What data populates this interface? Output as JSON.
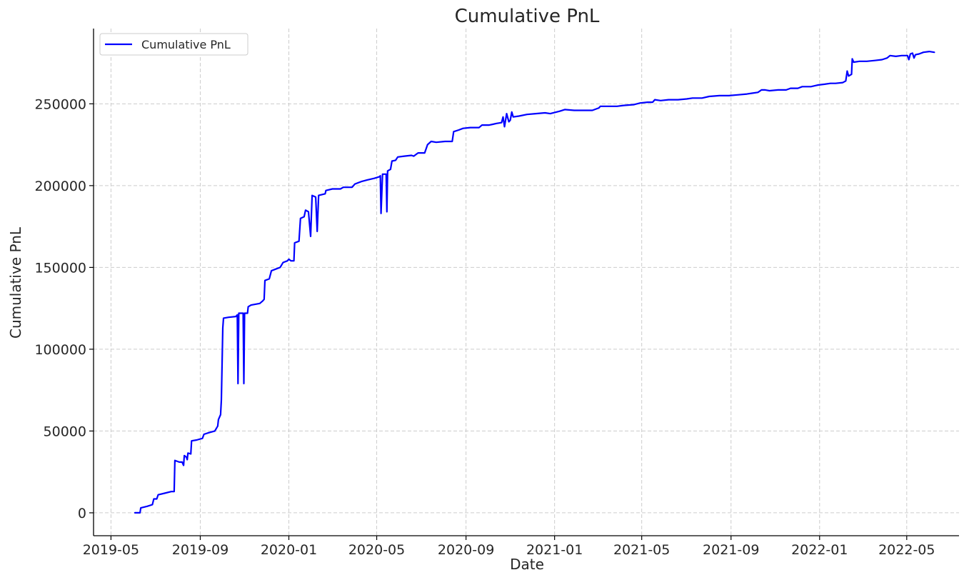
{
  "chart_data": {
    "type": "line",
    "title": "Cumulative PnL",
    "xlabel": "Date",
    "ylabel": "Cumulative PnL",
    "x_ticks": [
      "2019-05",
      "2019-09",
      "2020-01",
      "2020-05",
      "2020-09",
      "2021-01",
      "2021-05",
      "2021-09",
      "2022-01",
      "2022-05"
    ],
    "y_ticks": [
      0,
      50000,
      100000,
      150000,
      200000,
      250000
    ],
    "y_tick_labels": [
      "0",
      "50000",
      "100000",
      "150000",
      "200000",
      "250000"
    ],
    "xlim": [
      "2019-04-07",
      "2022-07-12"
    ],
    "ylim": [
      -14000,
      296000
    ],
    "grid": true,
    "legend": {
      "position": "top-left"
    },
    "series": [
      {
        "name": "Cumulative PnL",
        "color": "#0000ff",
        "points": [
          [
            "2019-06-03",
            0
          ],
          [
            "2019-06-10",
            0
          ],
          [
            "2019-06-11",
            3000
          ],
          [
            "2019-06-20",
            4000
          ],
          [
            "2019-06-27",
            5000
          ],
          [
            "2019-06-29",
            8500
          ],
          [
            "2019-07-03",
            8500
          ],
          [
            "2019-07-05",
            11000
          ],
          [
            "2019-07-14",
            12000
          ],
          [
            "2019-07-23",
            13000
          ],
          [
            "2019-07-27",
            13000
          ],
          [
            "2019-07-28",
            32000
          ],
          [
            "2019-08-03",
            31000
          ],
          [
            "2019-08-07",
            31000
          ],
          [
            "2019-08-09",
            29000
          ],
          [
            "2019-08-10",
            35000
          ],
          [
            "2019-08-13",
            34000
          ],
          [
            "2019-08-14",
            32500
          ],
          [
            "2019-08-15",
            36500
          ],
          [
            "2019-08-19",
            36000
          ],
          [
            "2019-08-20",
            44000
          ],
          [
            "2019-08-27",
            44500
          ],
          [
            "2019-09-04",
            45500
          ],
          [
            "2019-09-06",
            48000
          ],
          [
            "2019-09-13",
            49000
          ],
          [
            "2019-09-21",
            50000
          ],
          [
            "2019-09-25",
            53000
          ],
          [
            "2019-09-26",
            57000
          ],
          [
            "2019-09-29",
            60000
          ],
          [
            "2019-09-30",
            69000
          ],
          [
            "2019-10-02",
            113000
          ],
          [
            "2019-10-03",
            119000
          ],
          [
            "2019-10-10",
            119500
          ],
          [
            "2019-10-20",
            120000
          ],
          [
            "2019-10-22",
            121000
          ],
          [
            "2019-10-23",
            79000
          ],
          [
            "2019-10-24",
            122000
          ],
          [
            "2019-10-30",
            122000
          ],
          [
            "2019-10-31",
            79000
          ],
          [
            "2019-11-01",
            122000
          ],
          [
            "2019-11-05",
            122000
          ],
          [
            "2019-11-06",
            126000
          ],
          [
            "2019-11-10",
            127000
          ],
          [
            "2019-11-22",
            128000
          ],
          [
            "2019-11-26",
            129500
          ],
          [
            "2019-11-28",
            130500
          ],
          [
            "2019-11-29",
            142000
          ],
          [
            "2019-12-05",
            143000
          ],
          [
            "2019-12-08",
            148000
          ],
          [
            "2019-12-14",
            149000
          ],
          [
            "2019-12-20",
            150000
          ],
          [
            "2019-12-24",
            153000
          ],
          [
            "2019-12-30",
            154000
          ],
          [
            "2020-01-01",
            155000
          ],
          [
            "2020-01-04",
            154000
          ],
          [
            "2020-01-08",
            154000
          ],
          [
            "2020-01-09",
            165000
          ],
          [
            "2020-01-15",
            166000
          ],
          [
            "2020-01-17",
            180000
          ],
          [
            "2020-01-22",
            181000
          ],
          [
            "2020-01-24",
            185000
          ],
          [
            "2020-01-28",
            184000
          ],
          [
            "2020-01-31",
            169000
          ],
          [
            "2020-02-02",
            194000
          ],
          [
            "2020-02-07",
            193000
          ],
          [
            "2020-02-09",
            172000
          ],
          [
            "2020-02-11",
            194000
          ],
          [
            "2020-02-20",
            195000
          ],
          [
            "2020-02-21",
            197000
          ],
          [
            "2020-03-01",
            198000
          ],
          [
            "2020-03-12",
            198000
          ],
          [
            "2020-03-16",
            199000
          ],
          [
            "2020-03-28",
            199000
          ],
          [
            "2020-04-01",
            201000
          ],
          [
            "2020-04-10",
            202500
          ],
          [
            "2020-04-18",
            203500
          ],
          [
            "2020-04-28",
            204500
          ],
          [
            "2020-05-05",
            205500
          ],
          [
            "2020-05-06",
            206000
          ],
          [
            "2020-05-07",
            183000
          ],
          [
            "2020-05-09",
            207000
          ],
          [
            "2020-05-14",
            207000
          ],
          [
            "2020-05-15",
            184000
          ],
          [
            "2020-05-16",
            209000
          ],
          [
            "2020-05-20",
            210000
          ],
          [
            "2020-05-22",
            215000
          ],
          [
            "2020-05-27",
            215500
          ],
          [
            "2020-05-30",
            217500
          ],
          [
            "2020-06-08",
            218000
          ],
          [
            "2020-06-18",
            218500
          ],
          [
            "2020-06-21",
            218000
          ],
          [
            "2020-06-24",
            219000
          ],
          [
            "2020-06-27",
            220000
          ],
          [
            "2020-07-06",
            220000
          ],
          [
            "2020-07-10",
            225000
          ],
          [
            "2020-07-15",
            227000
          ],
          [
            "2020-07-22",
            226500
          ],
          [
            "2020-08-03",
            227000
          ],
          [
            "2020-08-13",
            227000
          ],
          [
            "2020-08-15",
            233000
          ],
          [
            "2020-08-22",
            234000
          ],
          [
            "2020-08-28",
            235000
          ],
          [
            "2020-09-07",
            235500
          ],
          [
            "2020-09-19",
            235500
          ],
          [
            "2020-09-23",
            237000
          ],
          [
            "2020-10-03",
            237000
          ],
          [
            "2020-10-08",
            237500
          ],
          [
            "2020-10-13",
            238000
          ],
          [
            "2020-10-20",
            238500
          ],
          [
            "2020-10-22",
            242000
          ],
          [
            "2020-10-24",
            236000
          ],
          [
            "2020-10-27",
            244000
          ],
          [
            "2020-10-30",
            239000
          ],
          [
            "2020-11-01",
            240000
          ],
          [
            "2020-11-03",
            245000
          ],
          [
            "2020-11-05",
            242000
          ],
          [
            "2020-11-13",
            242500
          ],
          [
            "2020-11-24",
            243500
          ],
          [
            "2020-12-06",
            244000
          ],
          [
            "2020-12-19",
            244500
          ],
          [
            "2020-12-26",
            244000
          ],
          [
            "2021-01-08",
            245500
          ],
          [
            "2021-01-15",
            246500
          ],
          [
            "2021-01-28",
            246000
          ],
          [
            "2021-02-10",
            246000
          ],
          [
            "2021-02-22",
            246000
          ],
          [
            "2021-03-03",
            247500
          ],
          [
            "2021-03-05",
            248500
          ],
          [
            "2021-03-15",
            248500
          ],
          [
            "2021-03-28",
            248500
          ],
          [
            "2021-04-06",
            249000
          ],
          [
            "2021-04-20",
            249500
          ],
          [
            "2021-04-29",
            250500
          ],
          [
            "2021-05-09",
            251000
          ],
          [
            "2021-05-16",
            251000
          ],
          [
            "2021-05-19",
            252500
          ],
          [
            "2021-05-27",
            252000
          ],
          [
            "2021-06-07",
            252500
          ],
          [
            "2021-06-20",
            252500
          ],
          [
            "2021-07-02",
            253000
          ],
          [
            "2021-07-10",
            253500
          ],
          [
            "2021-07-23",
            253500
          ],
          [
            "2021-08-02",
            254500
          ],
          [
            "2021-08-16",
            255000
          ],
          [
            "2021-08-29",
            255000
          ],
          [
            "2021-09-10",
            255500
          ],
          [
            "2021-09-23",
            256000
          ],
          [
            "2021-09-30",
            256500
          ],
          [
            "2021-10-08",
            257000
          ],
          [
            "2021-10-13",
            258500
          ],
          [
            "2021-10-18",
            258500
          ],
          [
            "2021-10-24",
            258000
          ],
          [
            "2021-11-05",
            258500
          ],
          [
            "2021-11-16",
            258500
          ],
          [
            "2021-11-22",
            259500
          ],
          [
            "2021-12-02",
            259500
          ],
          [
            "2021-12-08",
            260500
          ],
          [
            "2021-12-20",
            260500
          ],
          [
            "2021-12-30",
            261500
          ],
          [
            "2022-01-08",
            262000
          ],
          [
            "2022-01-16",
            262500
          ],
          [
            "2022-01-23",
            262500
          ],
          [
            "2022-02-02",
            263000
          ],
          [
            "2022-02-06",
            264000
          ],
          [
            "2022-02-08",
            270000
          ],
          [
            "2022-02-10",
            267000
          ],
          [
            "2022-02-14",
            268000
          ],
          [
            "2022-02-15",
            277500
          ],
          [
            "2022-02-17",
            275500
          ],
          [
            "2022-02-25",
            276000
          ],
          [
            "2022-03-07",
            276000
          ],
          [
            "2022-03-18",
            276500
          ],
          [
            "2022-03-28",
            277000
          ],
          [
            "2022-04-04",
            278000
          ],
          [
            "2022-04-08",
            279500
          ],
          [
            "2022-04-16",
            279000
          ],
          [
            "2022-04-24",
            279500
          ],
          [
            "2022-05-02",
            279500
          ],
          [
            "2022-05-04",
            277000
          ],
          [
            "2022-05-06",
            280500
          ],
          [
            "2022-05-09",
            281000
          ],
          [
            "2022-05-11",
            278000
          ],
          [
            "2022-05-13",
            280000
          ],
          [
            "2022-05-18",
            280500
          ],
          [
            "2022-05-24",
            281500
          ],
          [
            "2022-06-01",
            282000
          ],
          [
            "2022-06-08",
            281500
          ]
        ]
      }
    ]
  }
}
